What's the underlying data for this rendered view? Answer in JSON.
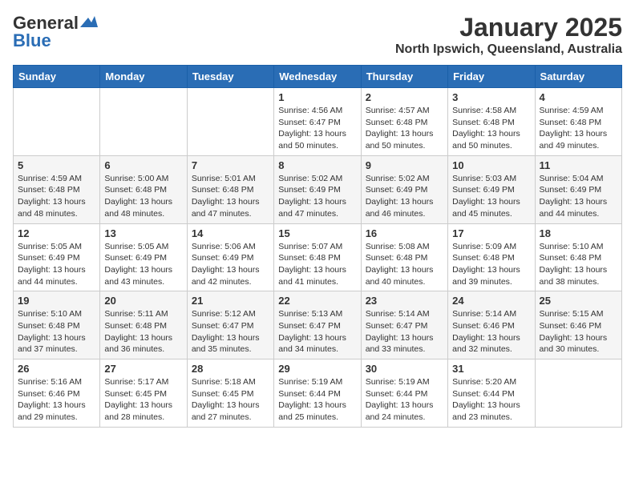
{
  "header": {
    "logo_general": "General",
    "logo_blue": "Blue",
    "month": "January 2025",
    "location": "North Ipswich, Queensland, Australia"
  },
  "weekdays": [
    "Sunday",
    "Monday",
    "Tuesday",
    "Wednesday",
    "Thursday",
    "Friday",
    "Saturday"
  ],
  "weeks": [
    [
      {
        "date": "",
        "info": ""
      },
      {
        "date": "",
        "info": ""
      },
      {
        "date": "",
        "info": ""
      },
      {
        "date": "1",
        "info": "Sunrise: 4:56 AM\nSunset: 6:47 PM\nDaylight: 13 hours\nand 50 minutes."
      },
      {
        "date": "2",
        "info": "Sunrise: 4:57 AM\nSunset: 6:48 PM\nDaylight: 13 hours\nand 50 minutes."
      },
      {
        "date": "3",
        "info": "Sunrise: 4:58 AM\nSunset: 6:48 PM\nDaylight: 13 hours\nand 50 minutes."
      },
      {
        "date": "4",
        "info": "Sunrise: 4:59 AM\nSunset: 6:48 PM\nDaylight: 13 hours\nand 49 minutes."
      }
    ],
    [
      {
        "date": "5",
        "info": "Sunrise: 4:59 AM\nSunset: 6:48 PM\nDaylight: 13 hours\nand 48 minutes."
      },
      {
        "date": "6",
        "info": "Sunrise: 5:00 AM\nSunset: 6:48 PM\nDaylight: 13 hours\nand 48 minutes."
      },
      {
        "date": "7",
        "info": "Sunrise: 5:01 AM\nSunset: 6:48 PM\nDaylight: 13 hours\nand 47 minutes."
      },
      {
        "date": "8",
        "info": "Sunrise: 5:02 AM\nSunset: 6:49 PM\nDaylight: 13 hours\nand 47 minutes."
      },
      {
        "date": "9",
        "info": "Sunrise: 5:02 AM\nSunset: 6:49 PM\nDaylight: 13 hours\nand 46 minutes."
      },
      {
        "date": "10",
        "info": "Sunrise: 5:03 AM\nSunset: 6:49 PM\nDaylight: 13 hours\nand 45 minutes."
      },
      {
        "date": "11",
        "info": "Sunrise: 5:04 AM\nSunset: 6:49 PM\nDaylight: 13 hours\nand 44 minutes."
      }
    ],
    [
      {
        "date": "12",
        "info": "Sunrise: 5:05 AM\nSunset: 6:49 PM\nDaylight: 13 hours\nand 44 minutes."
      },
      {
        "date": "13",
        "info": "Sunrise: 5:05 AM\nSunset: 6:49 PM\nDaylight: 13 hours\nand 43 minutes."
      },
      {
        "date": "14",
        "info": "Sunrise: 5:06 AM\nSunset: 6:49 PM\nDaylight: 13 hours\nand 42 minutes."
      },
      {
        "date": "15",
        "info": "Sunrise: 5:07 AM\nSunset: 6:48 PM\nDaylight: 13 hours\nand 41 minutes."
      },
      {
        "date": "16",
        "info": "Sunrise: 5:08 AM\nSunset: 6:48 PM\nDaylight: 13 hours\nand 40 minutes."
      },
      {
        "date": "17",
        "info": "Sunrise: 5:09 AM\nSunset: 6:48 PM\nDaylight: 13 hours\nand 39 minutes."
      },
      {
        "date": "18",
        "info": "Sunrise: 5:10 AM\nSunset: 6:48 PM\nDaylight: 13 hours\nand 38 minutes."
      }
    ],
    [
      {
        "date": "19",
        "info": "Sunrise: 5:10 AM\nSunset: 6:48 PM\nDaylight: 13 hours\nand 37 minutes."
      },
      {
        "date": "20",
        "info": "Sunrise: 5:11 AM\nSunset: 6:48 PM\nDaylight: 13 hours\nand 36 minutes."
      },
      {
        "date": "21",
        "info": "Sunrise: 5:12 AM\nSunset: 6:47 PM\nDaylight: 13 hours\nand 35 minutes."
      },
      {
        "date": "22",
        "info": "Sunrise: 5:13 AM\nSunset: 6:47 PM\nDaylight: 13 hours\nand 34 minutes."
      },
      {
        "date": "23",
        "info": "Sunrise: 5:14 AM\nSunset: 6:47 PM\nDaylight: 13 hours\nand 33 minutes."
      },
      {
        "date": "24",
        "info": "Sunrise: 5:14 AM\nSunset: 6:46 PM\nDaylight: 13 hours\nand 32 minutes."
      },
      {
        "date": "25",
        "info": "Sunrise: 5:15 AM\nSunset: 6:46 PM\nDaylight: 13 hours\nand 30 minutes."
      }
    ],
    [
      {
        "date": "26",
        "info": "Sunrise: 5:16 AM\nSunset: 6:46 PM\nDaylight: 13 hours\nand 29 minutes."
      },
      {
        "date": "27",
        "info": "Sunrise: 5:17 AM\nSunset: 6:45 PM\nDaylight: 13 hours\nand 28 minutes."
      },
      {
        "date": "28",
        "info": "Sunrise: 5:18 AM\nSunset: 6:45 PM\nDaylight: 13 hours\nand 27 minutes."
      },
      {
        "date": "29",
        "info": "Sunrise: 5:19 AM\nSunset: 6:44 PM\nDaylight: 13 hours\nand 25 minutes."
      },
      {
        "date": "30",
        "info": "Sunrise: 5:19 AM\nSunset: 6:44 PM\nDaylight: 13 hours\nand 24 minutes."
      },
      {
        "date": "31",
        "info": "Sunrise: 5:20 AM\nSunset: 6:44 PM\nDaylight: 13 hours\nand 23 minutes."
      },
      {
        "date": "",
        "info": ""
      }
    ]
  ]
}
